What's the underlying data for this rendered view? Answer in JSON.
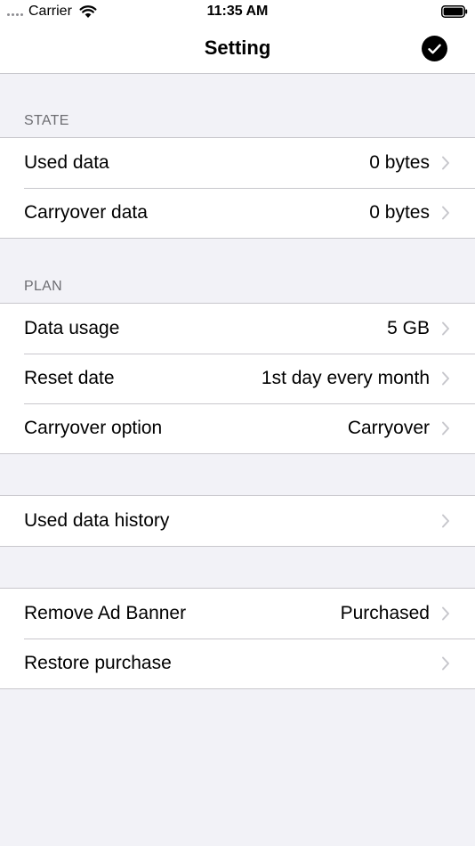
{
  "status_bar": {
    "carrier": "Carrier",
    "time": "11:35 AM"
  },
  "nav": {
    "title": "Setting"
  },
  "sections": {
    "state": {
      "header": "STATE",
      "rows": [
        {
          "label": "Used data",
          "value": "0 bytes"
        },
        {
          "label": "Carryover data",
          "value": "0 bytes"
        }
      ]
    },
    "plan": {
      "header": "PLAN",
      "rows": [
        {
          "label": "Data usage",
          "value": "5 GB"
        },
        {
          "label": "Reset date",
          "value": "1st day every month"
        },
        {
          "label": "Carryover option",
          "value": "Carryover"
        }
      ]
    },
    "history": {
      "rows": [
        {
          "label": "Used data history",
          "value": ""
        }
      ]
    },
    "purchase": {
      "rows": [
        {
          "label": "Remove Ad Banner",
          "value": "Purchased"
        },
        {
          "label": "Restore purchase",
          "value": ""
        }
      ]
    }
  },
  "colors": {
    "background": "#f2f2f7",
    "separator": "#c8c7cc",
    "section_header": "#6d6d72",
    "chevron": "#c7c7cc"
  }
}
